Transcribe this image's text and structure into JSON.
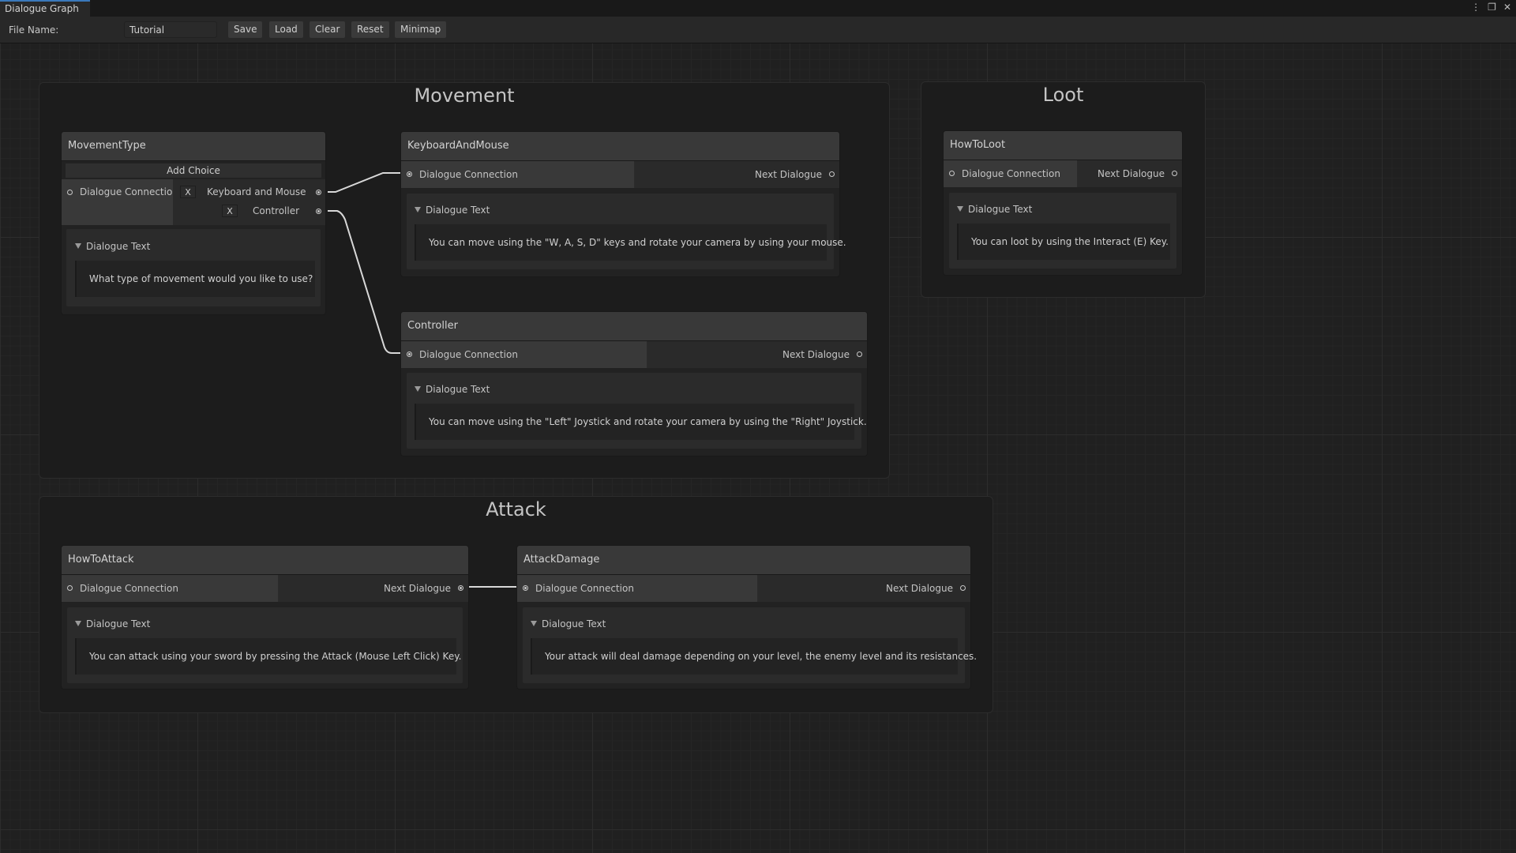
{
  "window": {
    "tab_title": "Dialogue Graph",
    "icons": [
      "kebab-menu-icon",
      "maximize-icon",
      "close-icon"
    ]
  },
  "toolbar": {
    "file_name_label": "File Name:",
    "file_name_value": "Tutorial",
    "save_label": "Save",
    "load_label": "Load",
    "clear_label": "Clear",
    "reset_label": "Reset",
    "minimap_label": "Minimap"
  },
  "groups": {
    "movement": "Movement",
    "loot": "Loot",
    "attack": "Attack"
  },
  "common": {
    "dialogue_connection": "Dialogue Connection",
    "next_dialogue": "Next Dialogue",
    "dialogue_text": "Dialogue Text",
    "add_choice": "Add Choice",
    "remove_choice": "X"
  },
  "nodes": {
    "movement_type": {
      "title": "MovementType",
      "choices": [
        "Keyboard and Mouse",
        "Controller"
      ],
      "text": "What type of movement would you like to use?"
    },
    "keyboard_and_mouse": {
      "title": "KeyboardAndMouse",
      "text": "You can move using the \"W, A, S, D\" keys and rotate your camera by using your mouse."
    },
    "controller": {
      "title": "Controller",
      "text": "You can move using the \"Left\" Joystick and rotate your camera by using the \"Right\" Joystick."
    },
    "how_to_loot": {
      "title": "HowToLoot",
      "text": "You can loot by using the Interact (E) Key."
    },
    "how_to_attack": {
      "title": "HowToAttack",
      "text": "You can attack using your sword by pressing the Attack (Mouse Left Click) Key."
    },
    "attack_damage": {
      "title": "AttackDamage",
      "text": "Your attack will deal damage depending on your level, the enemy level and its resistances."
    }
  }
}
